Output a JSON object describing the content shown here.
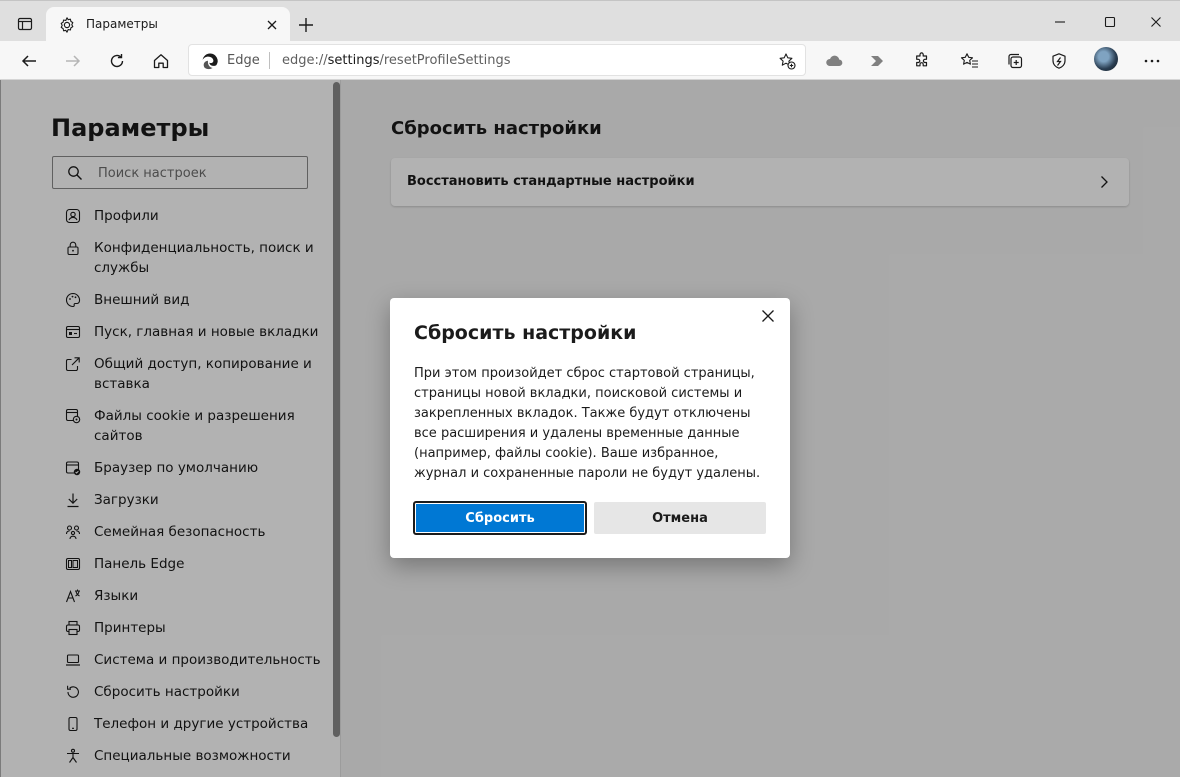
{
  "browser": {
    "tab_title": "Параметры",
    "site_label": "Edge",
    "url_prefix": "edge://",
    "url_host": "settings",
    "url_path": "/resetProfileSettings"
  },
  "sidebar": {
    "title": "Параметры",
    "search_placeholder": "Поиск настроек",
    "items": [
      {
        "label": "Профили",
        "icon": "profile-icon"
      },
      {
        "label": "Конфиденциальность, поиск и службы",
        "icon": "lock-icon"
      },
      {
        "label": "Внешний вид",
        "icon": "palette-icon"
      },
      {
        "label": "Пуск, главная и новые вкладки",
        "icon": "start-page-icon"
      },
      {
        "label": "Общий доступ, копирование и вставка",
        "icon": "share-icon"
      },
      {
        "label": "Файлы cookie и разрешения сайтов",
        "icon": "cookie-permissions-icon"
      },
      {
        "label": "Браузер по умолчанию",
        "icon": "default-browser-icon"
      },
      {
        "label": "Загрузки",
        "icon": "download-icon"
      },
      {
        "label": "Семейная безопасность",
        "icon": "family-icon"
      },
      {
        "label": "Панель Edge",
        "icon": "edge-bar-icon"
      },
      {
        "label": "Языки",
        "icon": "languages-icon"
      },
      {
        "label": "Принтеры",
        "icon": "printer-icon"
      },
      {
        "label": "Система и производительность",
        "icon": "laptop-icon"
      },
      {
        "label": "Сбросить настройки",
        "icon": "reset-icon"
      },
      {
        "label": "Телефон и другие устройства",
        "icon": "phone-icon"
      },
      {
        "label": "Специальные возможности",
        "icon": "accessibility-icon"
      }
    ]
  },
  "main": {
    "title": "Сбросить настройки",
    "card_label": "Восстановить стандартные настройки"
  },
  "dialog": {
    "title": "Сбросить настройки",
    "body": "При этом произойдет сброс стартовой страницы, страницы новой вкладки, поисковой системы и закрепленных вкладок. Также будут отключены все расширения и удалены временные данные (например, файлы cookie). Ваше избранное, журнал и сохраненные пароли не будут удалены.",
    "reset_label": "Сбросить",
    "cancel_label": "Отмена"
  },
  "colors": {
    "accent": "#0078d4",
    "overlay": "rgba(0,0,0,0.30)"
  }
}
